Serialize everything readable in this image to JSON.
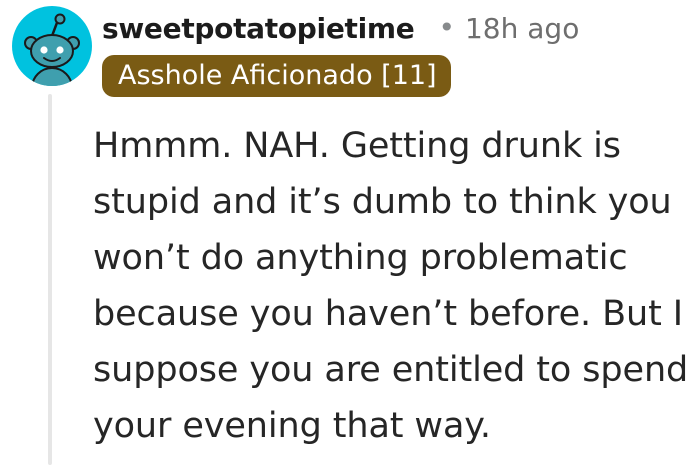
{
  "comment": {
    "author": "sweetpotatopietime",
    "separator": "•",
    "timestamp": "18h ago",
    "flair": "Asshole Aficionado [11]",
    "body": "Hmmm. NAH. Getting drunk is stupid and it’s dumb to think you won’t do anything problematic because you haven’t before. But I suppose you are entitled to spend your evening that way."
  },
  "colors": {
    "avatar_background": "#00c2df",
    "flair_background": "#7a5b14",
    "thread_line": "#e6e6e6"
  },
  "icons": {
    "avatar": "snoo-avatar-icon"
  }
}
